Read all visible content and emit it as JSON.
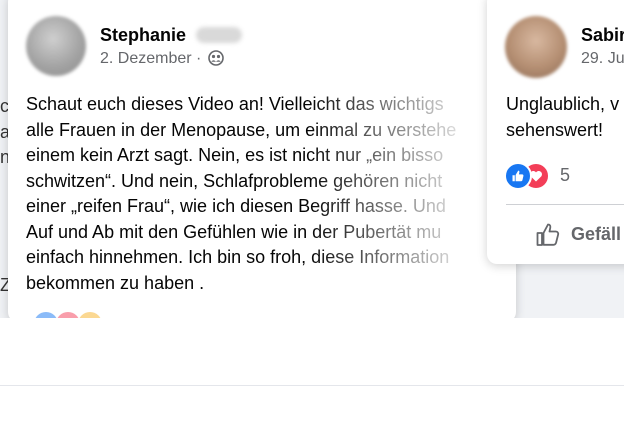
{
  "colors": {
    "background": "#f0f2f5",
    "card": "#ffffff",
    "primary_text": "#050505",
    "secondary_text": "#65676b",
    "like_blue": "#1877f2",
    "love_red": "#f33e58"
  },
  "main_post": {
    "author_first_name": "Stephanie",
    "date": "2. Dezember",
    "separator": "·",
    "audience_icon": "friends-icon",
    "text_lines": [
      "Schaut euch dieses Video an! Vielleicht das wichtigs",
      "alle Frauen in der Menopause, um einmal zu verstehe",
      "einem kein Arzt sagt. Nein, es ist nicht nur „ein bisso",
      "schwitzen“. Und nein, Schlafprobleme gehören nicht",
      "einer „reifen Frau“, wie ich diesen Begriff hasse. Und",
      "Auf und Ab mit den Gefühlen wie in der Pubertät mu",
      "einfach hinnehmen. Ich bin so froh, diese Information",
      "bekommen zu haben ."
    ]
  },
  "side_post": {
    "author_first_name": "Sabir",
    "date": "29. Ju",
    "text_lines": [
      "Unglaublich, v",
      "sehenswert!"
    ],
    "reaction_icons": [
      "like-reaction-icon",
      "love-reaction-icon"
    ],
    "reaction_count": "5",
    "like_action_icon": "thumbs-up-icon",
    "like_action_label": "Gefäll"
  },
  "left_peek": {
    "chars": [
      "c",
      "a",
      "n",
      "",
      "",
      "",
      "",
      "Z"
    ]
  }
}
